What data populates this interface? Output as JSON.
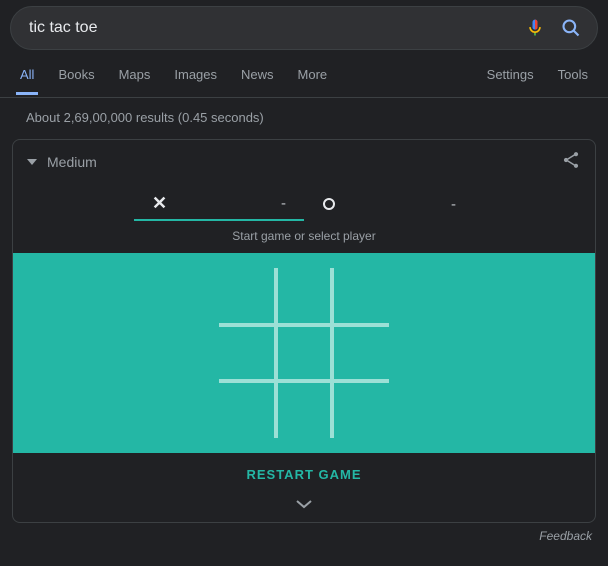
{
  "search": {
    "query": "tic tac toe"
  },
  "nav": {
    "items": [
      "All",
      "Books",
      "Maps",
      "Images",
      "News",
      "More"
    ],
    "right": [
      "Settings",
      "Tools"
    ]
  },
  "results_info": "About 2,69,00,000 results (0.45 seconds)",
  "game": {
    "difficulty_label": "Medium",
    "hint": "Start game or select player",
    "restart_label": "RESTART GAME",
    "scores": {
      "x": {
        "mark": "✕",
        "value": "-"
      },
      "o": {
        "mark": "O",
        "value": "-"
      }
    },
    "colors": {
      "board": "#24b7a5",
      "grid": "#9ce0d6",
      "accent": "#8ab4f8"
    }
  },
  "feedback_label": "Feedback"
}
